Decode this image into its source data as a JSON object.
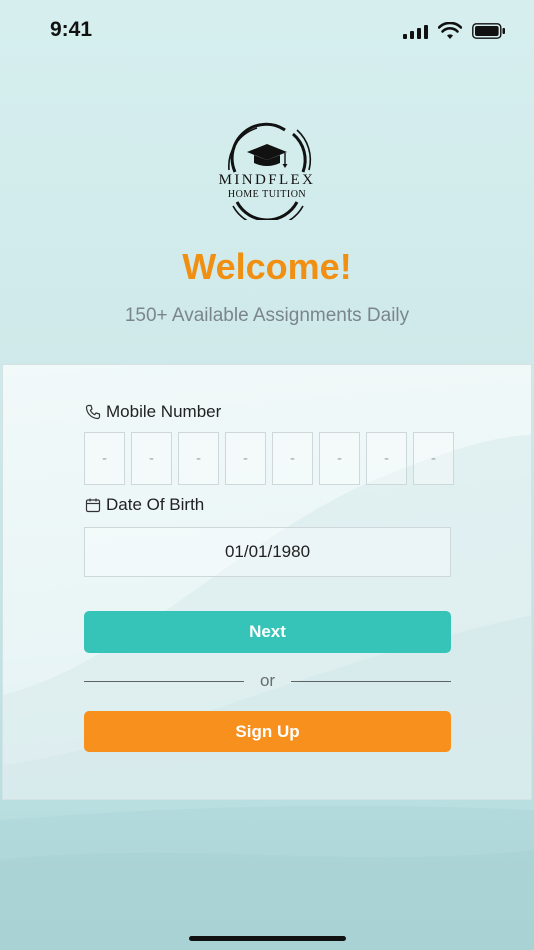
{
  "status_bar": {
    "time": "9:41",
    "icons": [
      "signal-icon",
      "wifi-icon",
      "battery-icon"
    ]
  },
  "logo": {
    "name": "MINDFLEX",
    "tagline": "HOME TUITION",
    "icon": "graduation-cap-icon"
  },
  "header": {
    "title": "Welcome!",
    "subtitle": "150+ Available Assignments Daily"
  },
  "form": {
    "mobile": {
      "label": "Mobile Number",
      "icon": "phone-icon",
      "digits": [
        "-",
        "-",
        "-",
        "-",
        "-",
        "-",
        "-",
        "-"
      ]
    },
    "dob": {
      "label": "Date Of Birth",
      "icon": "calendar-icon",
      "value": "01/01/1980"
    },
    "next_label": "Next",
    "or_label": "or",
    "signup_label": "Sign Up"
  },
  "colors": {
    "accent_orange": "#f08f12",
    "next_button": "#36c4b8",
    "signup_button": "#f8901e",
    "background": "#d6eeee"
  }
}
